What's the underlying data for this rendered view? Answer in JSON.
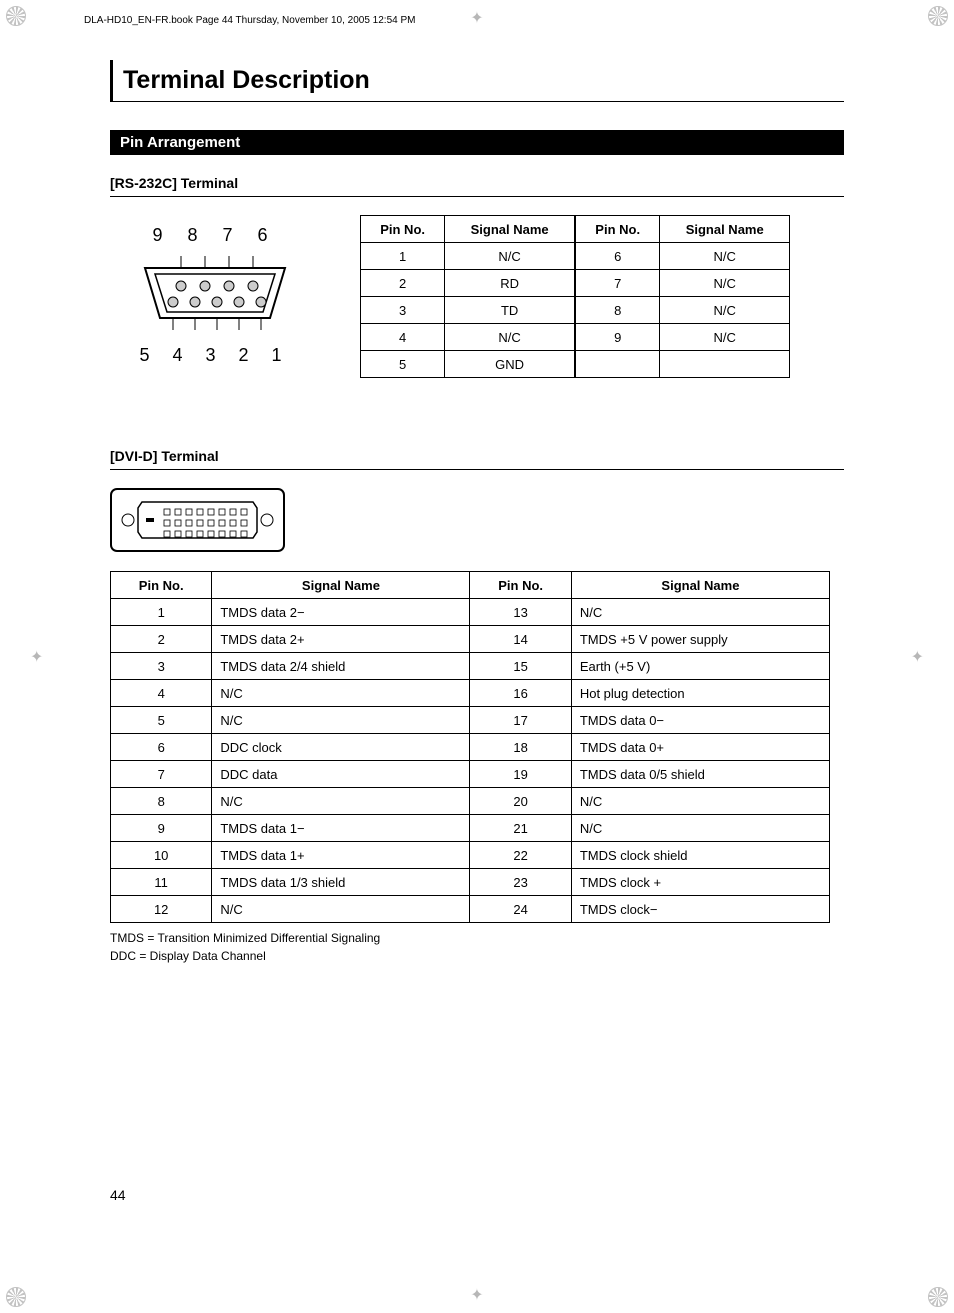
{
  "header_path": "DLA-HD10_EN-FR.book  Page 44  Thursday, November 10, 2005  12:54 PM",
  "title": "Terminal Description",
  "section": "Pin Arrangement",
  "rs232": {
    "heading": "[RS-232C] Terminal",
    "top_labels": "9 8 7 6",
    "bottom_labels": "5 4 3 2 1",
    "columns": [
      "Pin No.",
      "Signal Name",
      "Pin No.",
      "Signal Name"
    ],
    "rows": [
      [
        "1",
        "N/C",
        "6",
        "N/C"
      ],
      [
        "2",
        "RD",
        "7",
        "N/C"
      ],
      [
        "3",
        "TD",
        "8",
        "N/C"
      ],
      [
        "4",
        "N/C",
        "9",
        "N/C"
      ],
      [
        "5",
        "GND",
        "",
        ""
      ]
    ]
  },
  "dvid": {
    "heading": "[DVI-D] Terminal",
    "columns": [
      "Pin No.",
      "Signal Name",
      "Pin No.",
      "Signal Name"
    ],
    "rows": [
      [
        "1",
        "TMDS data 2−",
        "13",
        "N/C"
      ],
      [
        "2",
        "TMDS data 2+",
        "14",
        "TMDS +5 V power supply"
      ],
      [
        "3",
        "TMDS data 2/4 shield",
        "15",
        "Earth (+5 V)"
      ],
      [
        "4",
        "N/C",
        "16",
        "Hot plug detection"
      ],
      [
        "5",
        "N/C",
        "17",
        "TMDS data 0−"
      ],
      [
        "6",
        "DDC clock",
        "18",
        "TMDS data 0+"
      ],
      [
        "7",
        "DDC data",
        "19",
        "TMDS data 0/5 shield"
      ],
      [
        "8",
        "N/C",
        "20",
        "N/C"
      ],
      [
        "9",
        "TMDS data 1−",
        "21",
        "N/C"
      ],
      [
        "10",
        "TMDS data 1+",
        "22",
        "TMDS clock shield"
      ],
      [
        "11",
        "TMDS data 1/3 shield",
        "23",
        "TMDS clock +"
      ],
      [
        "12",
        "N/C",
        "24",
        "TMDS clock−"
      ]
    ],
    "notes": [
      "TMDS = Transition Minimized Differential Signaling",
      "DDC = Display Data Channel"
    ]
  },
  "page_number": "44"
}
